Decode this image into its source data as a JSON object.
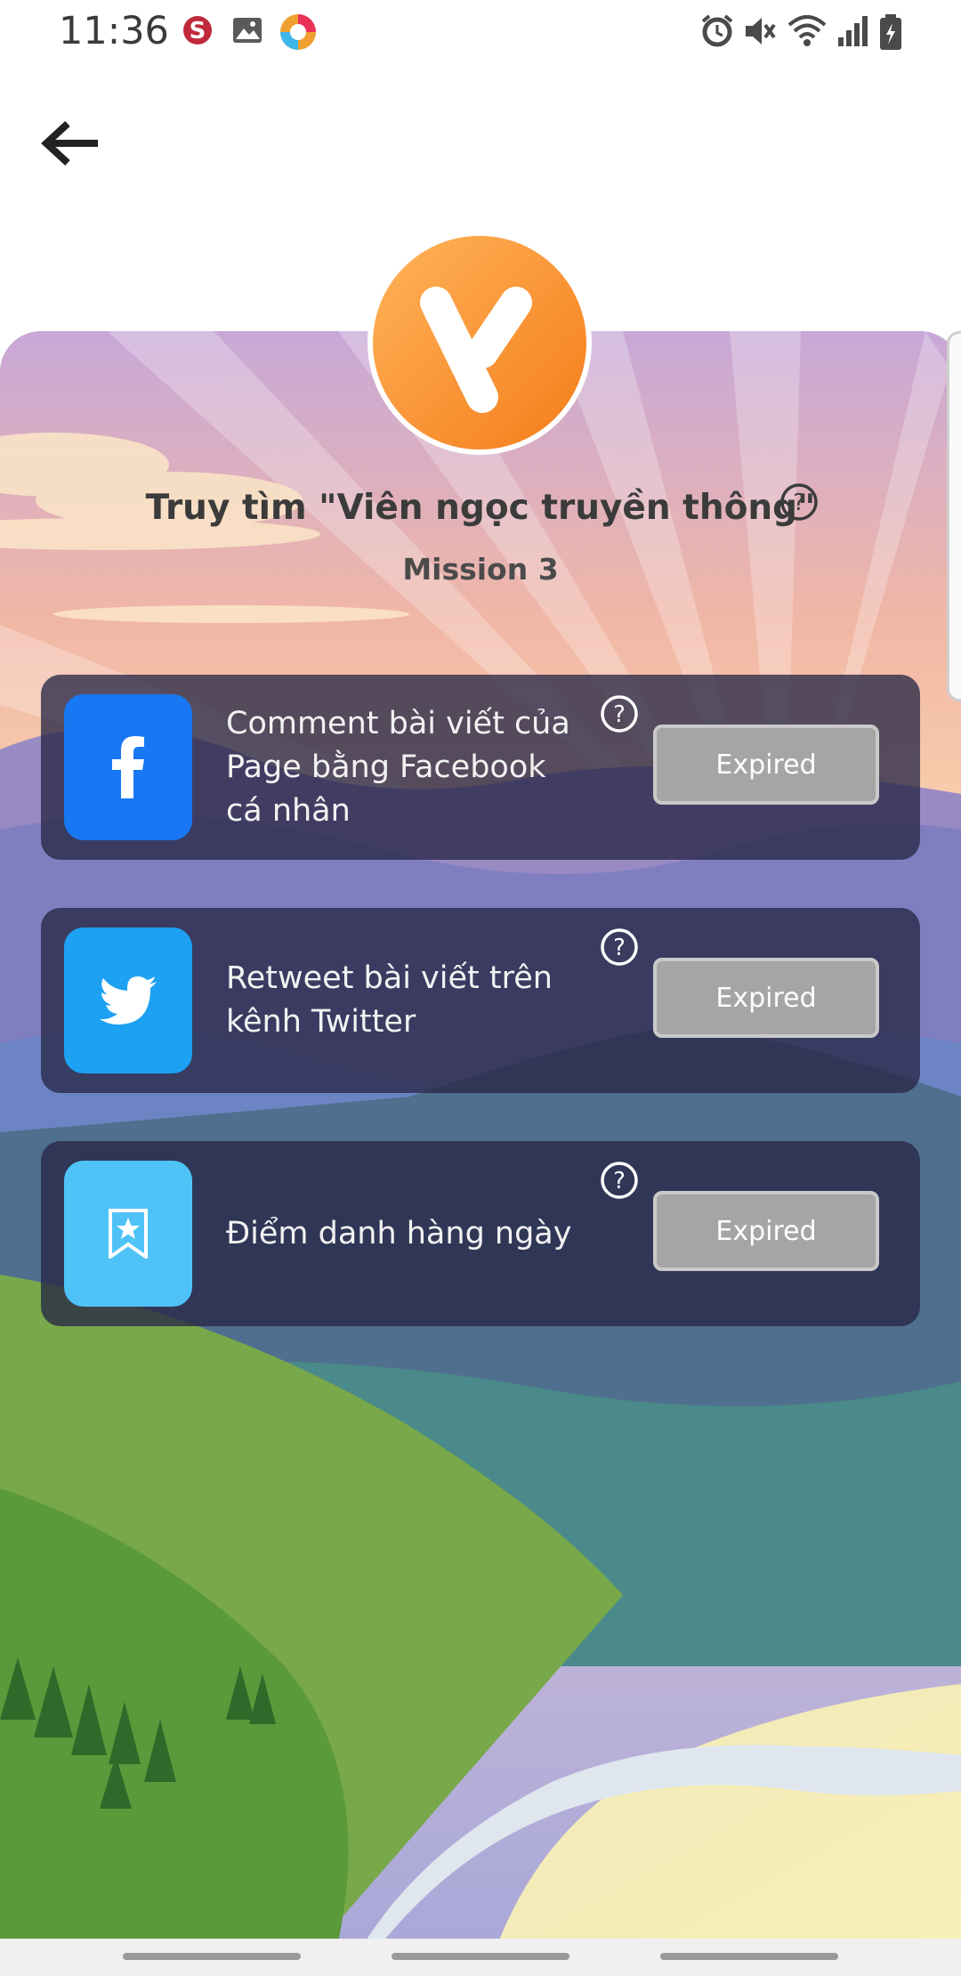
{
  "status_bar": {
    "time": "11:36"
  },
  "header": {
    "back_icon": "arrow-left-icon"
  },
  "mission": {
    "title": "Truy tìm \"Viên ngọc truyền thông\"",
    "subtitle": "Mission 3"
  },
  "tasks": [
    {
      "icon": "facebook-icon",
      "color": "#1877f2",
      "label": "Comment bài viết của\nPage bằng Facebook\ncá nhân",
      "button": "Expired"
    },
    {
      "icon": "twitter-icon",
      "color": "#1da1f2",
      "label": "Retweet bài viết trên\nkênh Twitter",
      "button": "Expired"
    },
    {
      "icon": "bookmark-star-icon",
      "color": "#4fc3f7",
      "label": "Điểm danh hàng ngày",
      "button": "Expired"
    }
  ]
}
